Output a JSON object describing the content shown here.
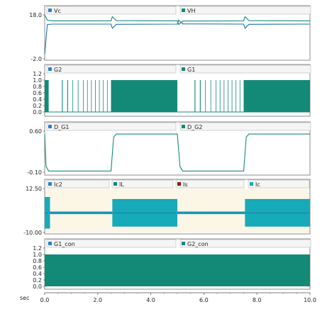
{
  "colors": {
    "teal": "#138A78",
    "blue": "#1F6FB3",
    "cyan": "#17AAB8",
    "darkred": "#8B1A1A",
    "legend_square": "#2A7FCF",
    "cream_bg": "#FBF6E6",
    "frame": "#8C8C8C",
    "grid": "#D6D6D6",
    "header_bg": "#F5F5F5"
  },
  "x_axis": {
    "unit_label": "sec",
    "min": 0.0,
    "max": 10.0,
    "ticks": [
      "0.0",
      "2.0",
      "4.0",
      "6.0",
      "8.0",
      "10.0"
    ]
  },
  "panels": [
    {
      "legend": [
        {
          "name": "Vc",
          "icon": "blue-square"
        },
        {
          "name": "VH",
          "icon": "teal-square"
        }
      ],
      "y_ticks": [
        "18.0",
        "-2.0"
      ]
    },
    {
      "legend": [
        {
          "name": "G2",
          "icon": "blue-square"
        },
        {
          "name": "G1",
          "icon": "teal-square"
        }
      ],
      "y_ticks": [
        "1.2",
        "1.0",
        "0.8",
        "0.6",
        "0.4",
        "0.2",
        "0.0"
      ]
    },
    {
      "legend": [
        {
          "name": "D_G1",
          "icon": "blue-square"
        },
        {
          "name": "D_G2",
          "icon": "teal-square"
        }
      ],
      "y_ticks": [
        "0.60",
        "-0.10"
      ]
    },
    {
      "legend": [
        {
          "name": "Ic2",
          "icon": "blue-square"
        },
        {
          "name": "IL",
          "icon": "teal-square"
        },
        {
          "name": "Is",
          "icon": "red-square"
        },
        {
          "name": "Ic",
          "icon": "cyan-square"
        }
      ],
      "y_ticks": [
        "12.50",
        "-10.00"
      ]
    },
    {
      "legend": [
        {
          "name": "G1_con",
          "icon": "blue-square"
        },
        {
          "name": "G2_con",
          "icon": "teal-square"
        }
      ],
      "y_ticks": [
        "1.2",
        "1.0",
        "0.8",
        "0.6",
        "0.4",
        "0.2",
        "0.0"
      ]
    }
  ],
  "chart_data": [
    {
      "type": "line",
      "ylim": [
        -2.0,
        18.0
      ],
      "series": [
        {
          "name": "Vc",
          "x": [
            0,
            0.1,
            0.3,
            2.5,
            2.55,
            2.7,
            5.0,
            5.05,
            5.2,
            7.5,
            7.55,
            7.7,
            10.0
          ],
          "y": [
            0,
            13.6,
            13.8,
            13.8,
            11.9,
            13.7,
            13.8,
            15.6,
            13.9,
            13.8,
            11.9,
            13.7,
            13.8
          ]
        },
        {
          "name": "VH",
          "x": [
            0,
            0.1,
            0.3,
            2.5,
            2.55,
            2.7,
            5.0,
            5.05,
            5.2,
            7.5,
            7.55,
            7.7,
            10.0
          ],
          "y": [
            18,
            15.6,
            15.3,
            15.3,
            17.2,
            15.4,
            15.3,
            13.6,
            15.2,
            15.3,
            17.2,
            15.4,
            15.3
          ]
        }
      ]
    },
    {
      "type": "line",
      "ylim": [
        0.0,
        1.2
      ],
      "series": [
        {
          "name": "G1",
          "on_intervals": [
            [
              0,
              0.15
            ],
            [
              0.65,
              0.68
            ],
            [
              0.85,
              0.88
            ],
            [
              1.05,
              1.07
            ],
            [
              1.25,
              1.27
            ],
            [
              1.45,
              1.47
            ],
            [
              1.6,
              1.62
            ],
            [
              1.75,
              1.77
            ],
            [
              1.9,
              1.92
            ],
            [
              2.05,
              2.07
            ],
            [
              2.2,
              2.22
            ],
            [
              2.35,
              2.37
            ],
            [
              2.5,
              5.0
            ],
            [
              5.65,
              5.68
            ],
            [
              5.85,
              5.88
            ],
            [
              6.05,
              6.07
            ],
            [
              6.25,
              6.27
            ],
            [
              6.45,
              6.47
            ],
            [
              6.6,
              6.62
            ],
            [
              6.75,
              6.77
            ],
            [
              6.9,
              6.92
            ],
            [
              7.05,
              7.07
            ],
            [
              7.2,
              7.22
            ],
            [
              7.35,
              7.37
            ],
            [
              7.5,
              10.0
            ]
          ],
          "high": 1.0,
          "low": 0.0
        }
      ]
    },
    {
      "type": "line",
      "ylim": [
        -0.1,
        0.6
      ],
      "series": [
        {
          "name": "D_G1",
          "x": [
            0,
            0.05,
            0.15,
            2.5,
            2.6,
            2.7,
            5.0,
            5.1,
            5.2,
            7.5,
            7.6,
            7.7,
            10.0
          ],
          "y": [
            0.55,
            0.0,
            -0.08,
            -0.08,
            0.5,
            0.55,
            0.55,
            0.0,
            -0.08,
            -0.08,
            0.5,
            0.55,
            0.55
          ]
        }
      ]
    },
    {
      "type": "line",
      "ylim": [
        -10.0,
        12.5
      ],
      "series": [
        {
          "name": "Ic",
          "envelope": [
            {
              "x": [
                0,
                0.2
              ],
              "high": 8,
              "low": -8
            },
            {
              "x": [
                0.2,
                2.55
              ],
              "high": 0.6,
              "low": -0.6
            },
            {
              "x": [
                2.55,
                5.0
              ],
              "high": 7.0,
              "low": -7.0
            },
            {
              "x": [
                5.0,
                7.55
              ],
              "high": 0.6,
              "low": -0.6
            },
            {
              "x": [
                7.55,
                10.0
              ],
              "high": 7.0,
              "low": -7.0
            }
          ]
        },
        {
          "name": "Ic2",
          "x": [
            0,
            0.2,
            2.55,
            5.0,
            7.55,
            10.0
          ],
          "y": [
            0,
            0,
            0,
            0,
            0,
            0
          ]
        }
      ]
    },
    {
      "type": "line",
      "ylim": [
        0.0,
        1.2
      ],
      "series": [
        {
          "name": "G1_con",
          "on_intervals": [
            [
              0,
              10.0
            ]
          ],
          "high": 1.0,
          "low": 0.0
        }
      ]
    }
  ]
}
